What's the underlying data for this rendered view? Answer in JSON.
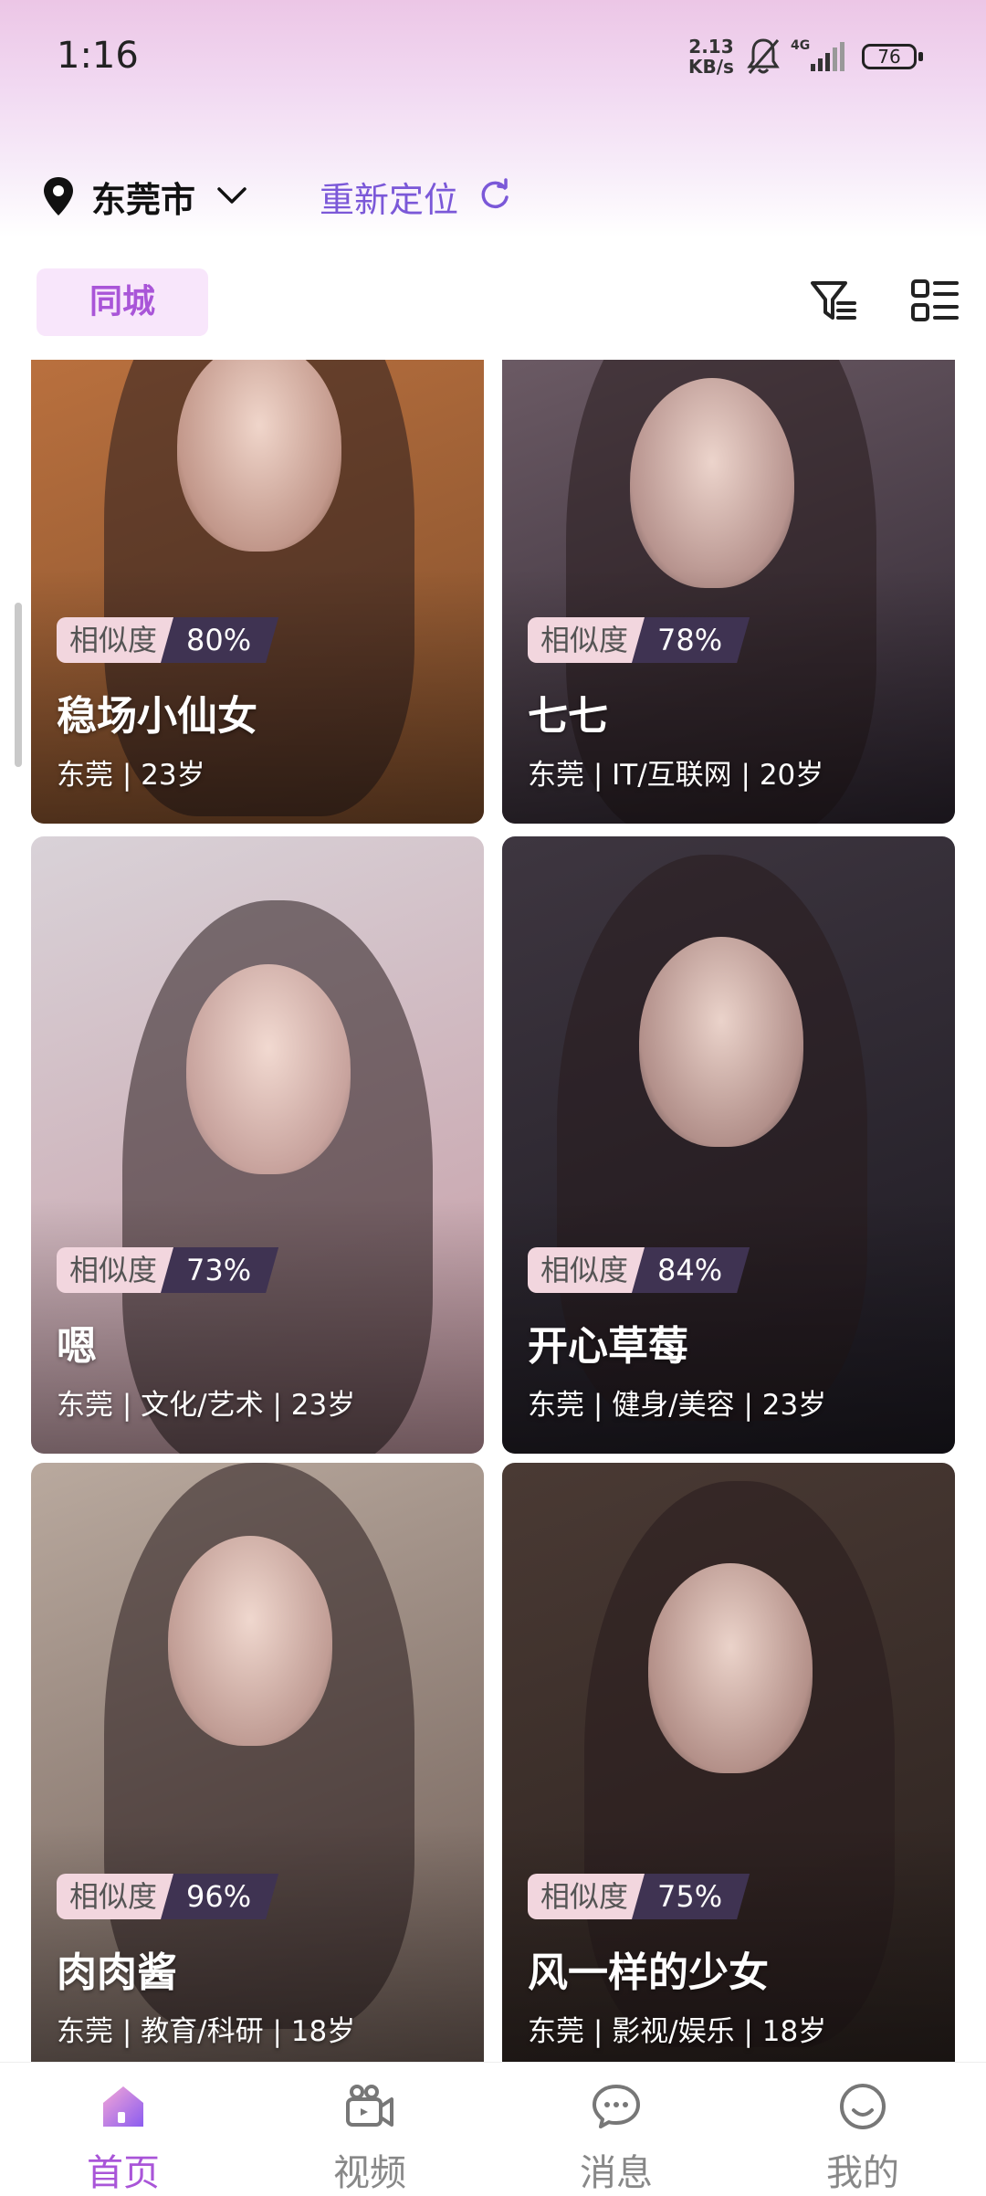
{
  "status_bar": {
    "time": "1:16",
    "net_speed_value": "2.13",
    "net_speed_unit": "KB/s",
    "network_type": "4G",
    "battery_level": "76"
  },
  "location": {
    "city": "东莞市",
    "relocate_label": "重新定位"
  },
  "tabs": {
    "active_label": "同城"
  },
  "profiles": [
    {
      "similarity_label": "相似度",
      "similarity": "80%",
      "name": "稳场小仙女",
      "meta": "东莞 | 23岁",
      "colors": [
        "#b9703e",
        "#7f4e2c"
      ]
    },
    {
      "similarity_label": "相似度",
      "similarity": "78%",
      "name": "七七",
      "meta": "东莞 | IT/互联网 | 20岁",
      "colors": [
        "#6b5a64",
        "#2d2530"
      ]
    },
    {
      "similarity_label": "相似度",
      "similarity": "73%",
      "name": "嗯",
      "meta": "东莞 | 文化/艺术 | 23岁",
      "colors": [
        "#d9d2d8",
        "#c59aa3"
      ]
    },
    {
      "similarity_label": "相似度",
      "similarity": "84%",
      "name": "开心草莓",
      "meta": "东莞 | 健身/美容 | 23岁",
      "colors": [
        "#3e3640",
        "#1d1a22"
      ]
    },
    {
      "similarity_label": "相似度",
      "similarity": "96%",
      "name": "肉肉酱",
      "meta": "东莞 | 教育/科研 | 18岁",
      "colors": [
        "#b9a99e",
        "#6c5b54"
      ]
    },
    {
      "similarity_label": "相似度",
      "similarity": "75%",
      "name": "风一样的少女",
      "meta": "东莞 | 影视/娱乐 | 18岁",
      "colors": [
        "#4a3a34",
        "#2a211e"
      ]
    }
  ],
  "bottom_nav": [
    {
      "label": "首页",
      "icon": "home-icon",
      "active": true
    },
    {
      "label": "视频",
      "icon": "video-icon",
      "active": false
    },
    {
      "label": "消息",
      "icon": "message-icon",
      "active": false
    },
    {
      "label": "我的",
      "icon": "profile-icon",
      "active": false
    }
  ],
  "colors": {
    "accent": "#a955d8",
    "relocate": "#7b58d8",
    "tab_bg": "#f8e6fb"
  }
}
